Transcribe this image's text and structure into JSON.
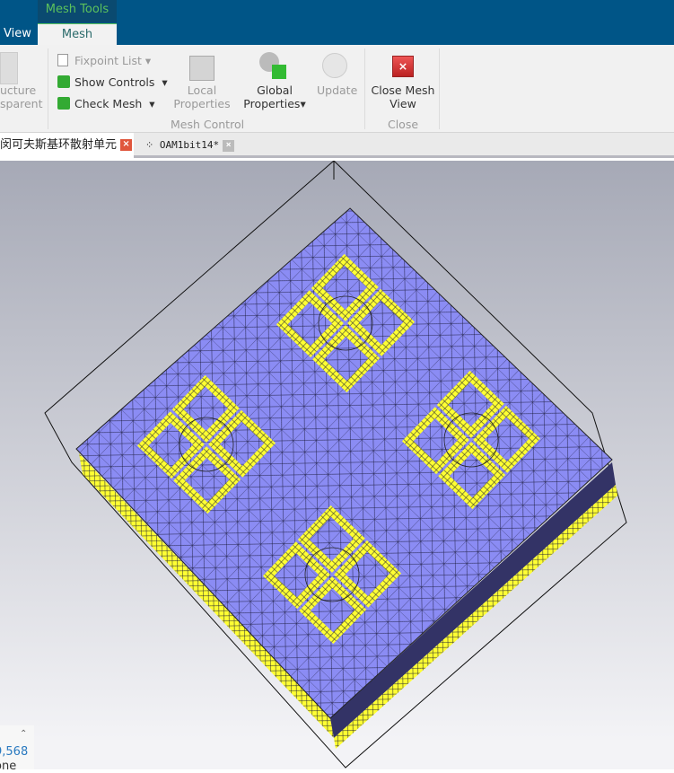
{
  "ribbon": {
    "context_tab": "Mesh Tools",
    "tabs": [
      {
        "label": "View"
      },
      {
        "label": "Mesh"
      }
    ],
    "structure_label_1": "ucture",
    "structure_label_2": "sparent",
    "fixpoint_list": "Fixpoint List",
    "show_controls": "Show Controls",
    "check_mesh": "Check Mesh",
    "local_properties_1": "Local",
    "local_properties_2": "Properties",
    "global_properties_1": "Global",
    "global_properties_2": "Properties",
    "update": "Update",
    "close_mesh_view_1": "Close Mesh",
    "close_mesh_view_2": "View",
    "group_mesh_control": "Mesh Control",
    "group_close": "Close"
  },
  "doc_tabs": [
    {
      "label": "闵可夫斯基环散射单元"
    },
    {
      "label": "OAM1bit14*"
    }
  ],
  "info_panel": {
    "value": "9,568",
    "label": "one"
  },
  "colors": {
    "mesh_face": "#8b8cf4",
    "side": "#333366",
    "pattern": "#ffff33",
    "title_bar": "#005587"
  }
}
